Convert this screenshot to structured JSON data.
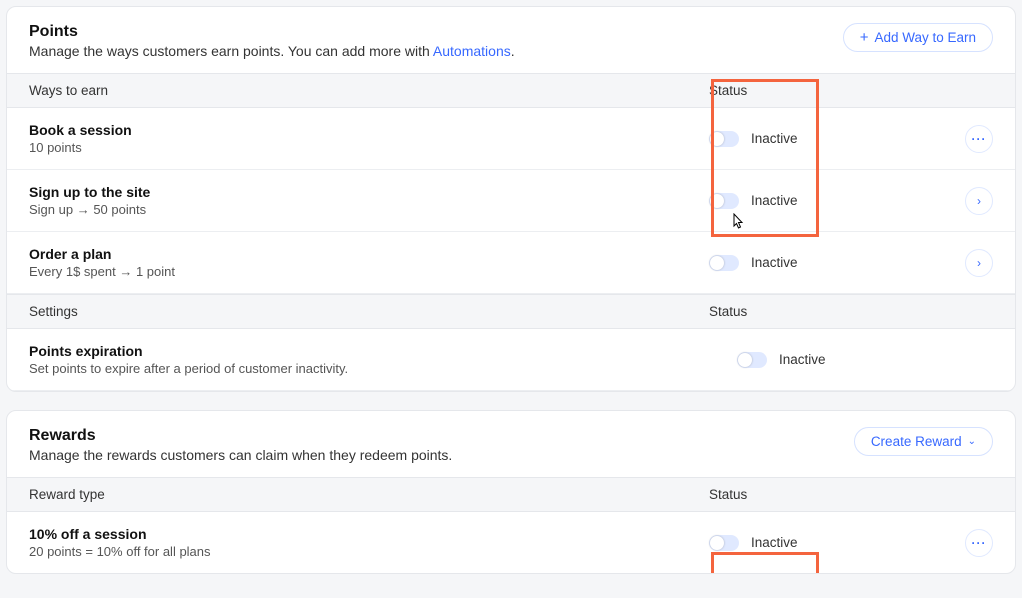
{
  "points": {
    "title": "Points",
    "subtitle_pre": "Manage the ways customers earn points. You can add more with ",
    "subtitle_link": "Automations",
    "subtitle_post": ".",
    "add_btn": "Add Way to Earn",
    "col_left": "Ways to earn",
    "col_status": "Status",
    "rows": [
      {
        "title": "Book a session",
        "sub": "10 points",
        "status": "Inactive",
        "action": "dots"
      },
      {
        "title": "Sign up to the site",
        "sub": "Sign up → 50 points",
        "status": "Inactive",
        "action": "chevron"
      },
      {
        "title": "Order a plan",
        "sub": "Every  1$ spent → 1 point",
        "status": "Inactive",
        "action": "chevron"
      }
    ],
    "settings_col_left": "Settings",
    "settings_col_status": "Status",
    "settings_row": {
      "title": "Points expiration",
      "sub": "Set points to expire after a period of customer inactivity.",
      "status": "Inactive"
    }
  },
  "rewards": {
    "title": "Rewards",
    "subtitle": "Manage the rewards customers can claim when they redeem points.",
    "create_btn": "Create Reward",
    "col_left": "Reward type",
    "col_status": "Status",
    "rows": [
      {
        "title": "10% off a session",
        "sub": "20 points = 10% off for all plans",
        "status": "Inactive",
        "action": "dots"
      }
    ]
  }
}
